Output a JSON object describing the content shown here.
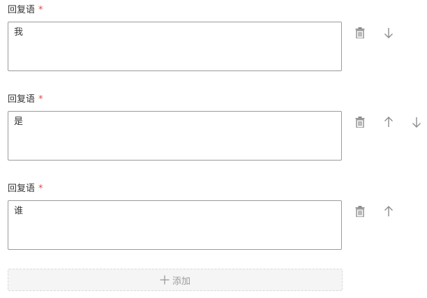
{
  "replies": [
    {
      "label": "回复语",
      "required_mark": "*",
      "value": "我",
      "actions": [
        "delete-icon",
        "arrow-down-icon"
      ]
    },
    {
      "label": "回复语",
      "required_mark": "*",
      "value": "是",
      "actions": [
        "delete-icon",
        "arrow-up-icon",
        "arrow-down-icon"
      ]
    },
    {
      "label": "回复语",
      "required_mark": "*",
      "value": "谁",
      "actions": [
        "delete-icon",
        "arrow-up-icon"
      ]
    }
  ],
  "add_button": {
    "icon": "plus-icon",
    "label": "添加"
  },
  "colors": {
    "required": "#e04a4a",
    "icon": "#8c8c8c",
    "border": "#9a9a9a",
    "add_bg": "#f5f5f5"
  }
}
